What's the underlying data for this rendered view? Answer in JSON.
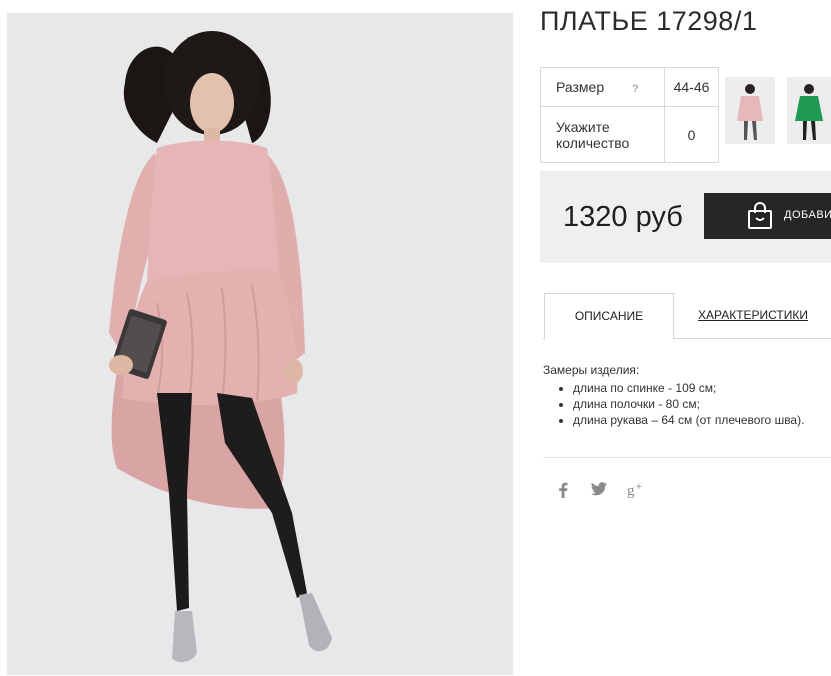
{
  "product": {
    "title": "ПЛАТЬЕ 17298/1",
    "photo_icon": "model-photo",
    "options": {
      "size_label": "Размер",
      "size_help": "?",
      "size_value": "44-46",
      "qty_label_line1": "Укажите",
      "qty_label_line2": "количество",
      "qty_value": "0"
    },
    "thumbnails": [
      {
        "icon": "pink-dress-thumbnail"
      },
      {
        "icon": "green-dress-thumbnail"
      }
    ],
    "price": "1320 руб",
    "add_button_label": "ДОБАВИТЬ",
    "tabs": [
      {
        "label": "ОПИСАНИЕ",
        "active": true
      },
      {
        "label": "ХАРАКТЕРИСТИКИ",
        "active": false
      }
    ],
    "description": {
      "heading": "Замеры изделия:",
      "items": [
        "длина по спинке - 109 см;",
        "длина полочки - 80 см;",
        "длина рукава – 64 см (от плечевого шва)."
      ]
    },
    "social": [
      {
        "icon": "facebook-icon",
        "glyph": "f"
      },
      {
        "icon": "twitter-icon",
        "glyph": "t"
      },
      {
        "icon": "google-plus-icon",
        "glyph": "g+"
      }
    ]
  },
  "colors": {
    "dress_pink": "#e3b3b2",
    "button_dark": "#262626",
    "price_bg": "#efefef"
  }
}
